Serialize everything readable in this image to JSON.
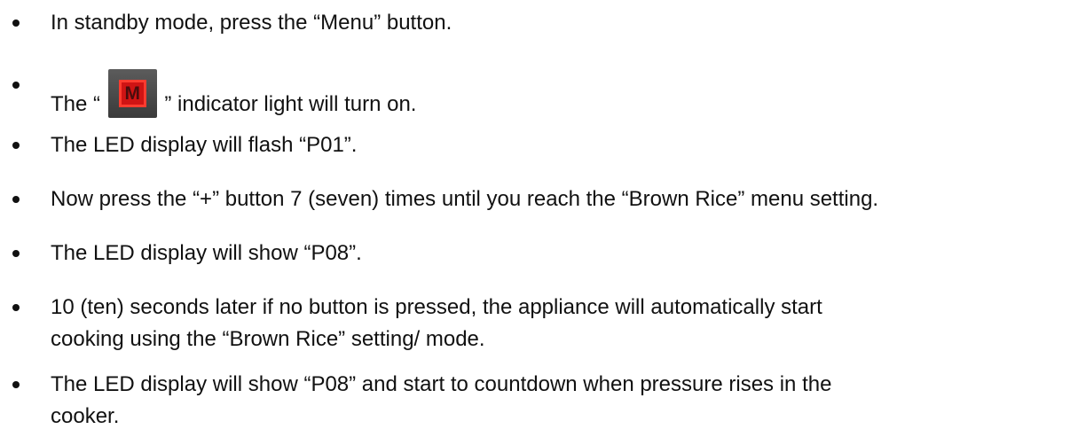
{
  "items": [
    {
      "text": "In standby mode, press the “Menu” button."
    },
    {
      "before": "The “ ",
      "icon": "menu-indicator-icon",
      "icon_glyph": "M",
      "after": " ” indicator light will turn on."
    },
    {
      "text": "The LED display will flash “P01”."
    },
    {
      "text": "Now press the “+” button 7 (seven) times until you reach the “Brown Rice” menu setting."
    },
    {
      "text": "The LED display will show “P08”."
    },
    {
      "line1": "10 (ten) seconds later if no button is pressed, the appliance will automatically start",
      "line2": "cooking using the “Brown Rice” setting/ mode."
    },
    {
      "line1": "The LED display will show “P08” and start to countdown when pressure rises in the",
      "line2": "cooker."
    }
  ]
}
